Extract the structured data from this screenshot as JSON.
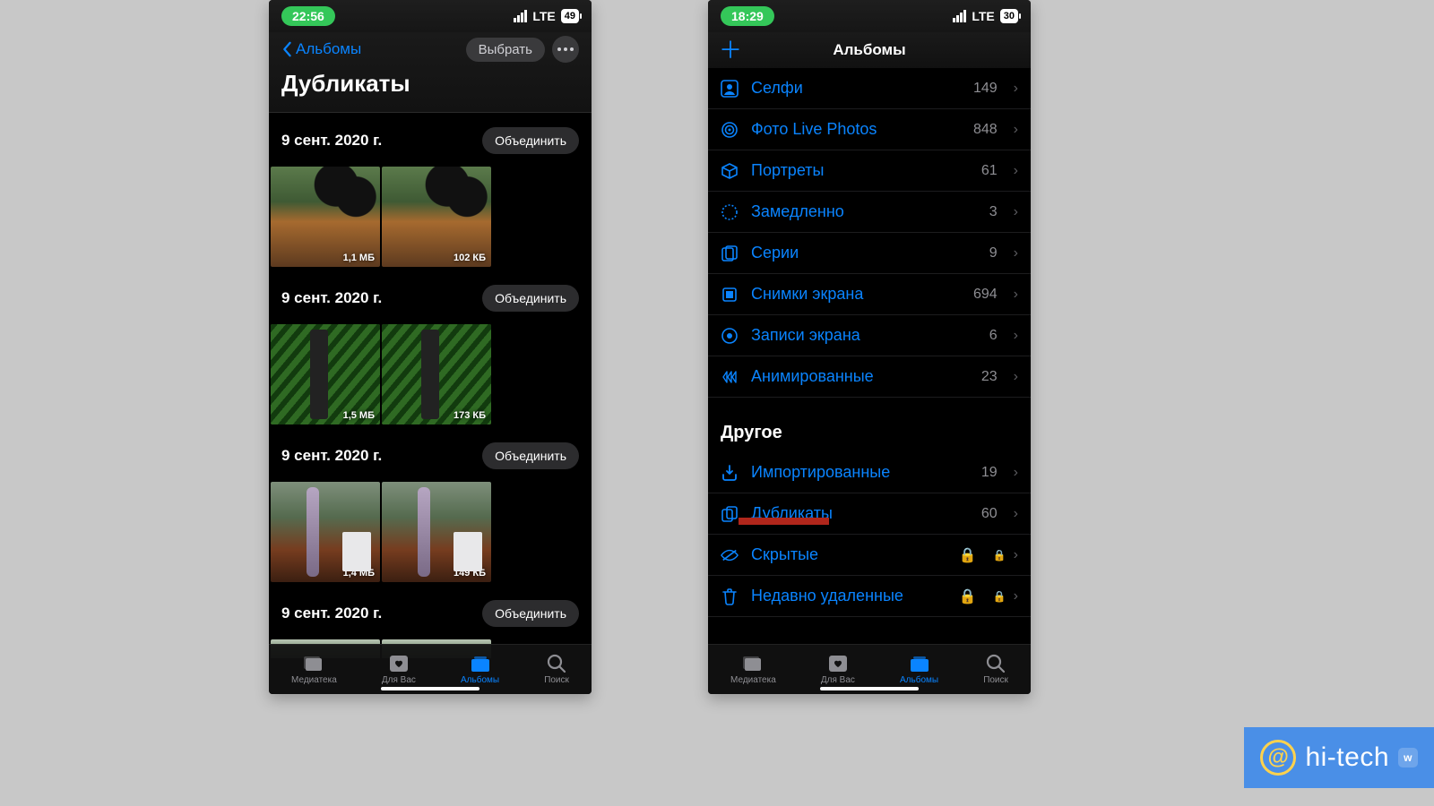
{
  "watermark": {
    "text": "hi-tech"
  },
  "left": {
    "status": {
      "time": "22:56",
      "carrier": "LTE",
      "battery": "49"
    },
    "nav": {
      "back": "Альбомы",
      "select": "Выбрать",
      "title": "Дубликаты"
    },
    "groups": [
      {
        "date": "9 сент. 2020 г.",
        "merge": "Объединить",
        "a_size": "1,1 МБ",
        "b_size": "102 КБ"
      },
      {
        "date": "9 сент. 2020 г.",
        "merge": "Объединить",
        "a_size": "1,5 МБ",
        "b_size": "173 КБ"
      },
      {
        "date": "9 сент. 2020 г.",
        "merge": "Объединить",
        "a_size": "1,4 МБ",
        "b_size": "149 КБ"
      },
      {
        "date": "9 сент. 2020 г.",
        "merge": "Объединить",
        "a_size": "",
        "b_size": ""
      }
    ],
    "tabs": {
      "library": "Медиатека",
      "for_you": "Для Вас",
      "albums": "Альбомы",
      "search": "Поиск"
    }
  },
  "right": {
    "status": {
      "time": "18:29",
      "carrier": "LTE",
      "battery": "30"
    },
    "title": "Альбомы",
    "types": [
      {
        "label": "Селфи",
        "count": "149"
      },
      {
        "label": "Фото Live Photos",
        "count": "848"
      },
      {
        "label": "Портреты",
        "count": "61"
      },
      {
        "label": "Замедленно",
        "count": "3"
      },
      {
        "label": "Серии",
        "count": "9"
      },
      {
        "label": "Снимки экрана",
        "count": "694"
      },
      {
        "label": "Записи экрана",
        "count": "6"
      },
      {
        "label": "Анимированные",
        "count": "23"
      }
    ],
    "other_header": "Другое",
    "other": [
      {
        "label": "Импортированные",
        "count": "19",
        "lock": false,
        "hl": false
      },
      {
        "label": "Дубликаты",
        "count": "60",
        "lock": false,
        "hl": true
      },
      {
        "label": "Скрытые",
        "count": "",
        "lock": true,
        "hl": false
      },
      {
        "label": "Недавно удаленные",
        "count": "",
        "lock": true,
        "hl": false
      }
    ],
    "tabs": {
      "library": "Медиатека",
      "for_you": "Для Вас",
      "albums": "Альбомы",
      "search": "Поиск"
    }
  }
}
